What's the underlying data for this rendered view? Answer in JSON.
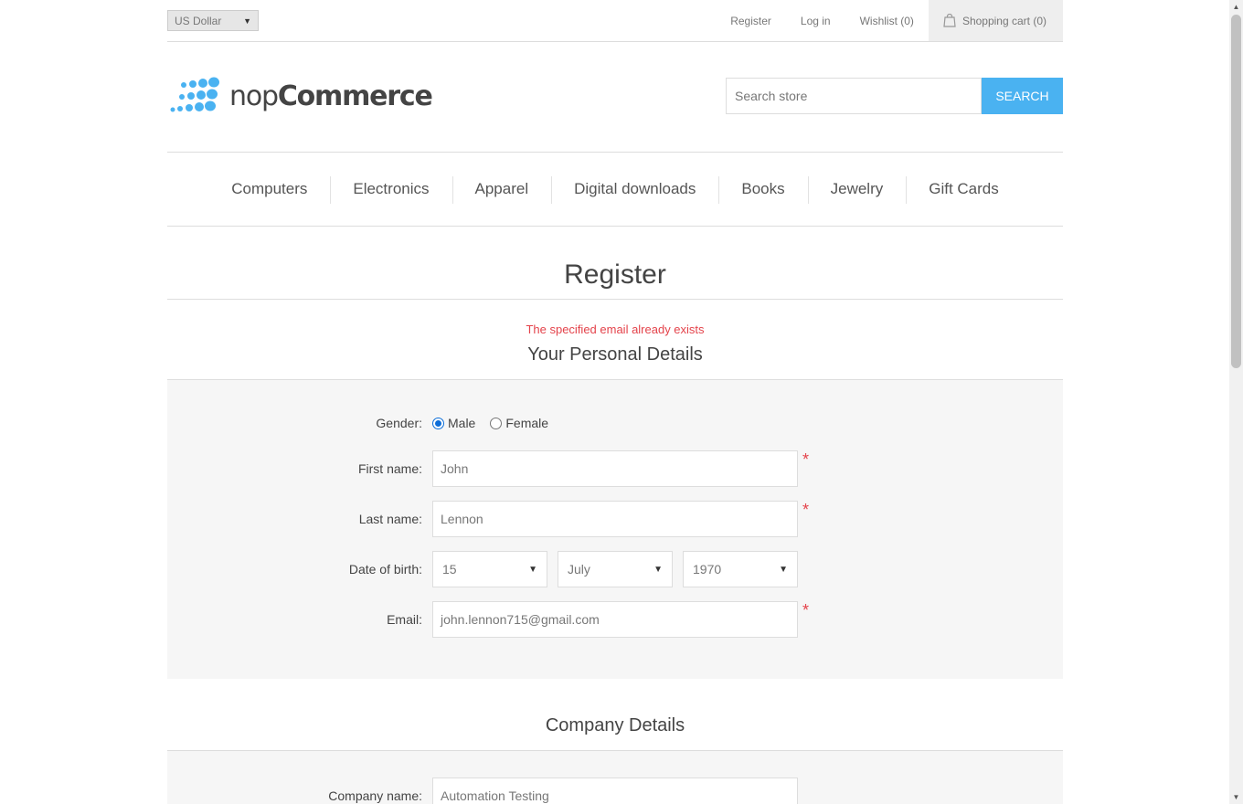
{
  "header": {
    "currency": "US Dollar",
    "links": {
      "register": "Register",
      "login": "Log in",
      "wishlist": "Wishlist (0)",
      "cart": "Shopping cart (0)"
    }
  },
  "logo": {
    "light": "nop",
    "bold": "Commerce",
    "color": "#4ab2f1"
  },
  "search": {
    "placeholder": "Search store",
    "button": "SEARCH"
  },
  "menu": [
    "Computers",
    "Electronics",
    "Apparel",
    "Digital downloads",
    "Books",
    "Jewelry",
    "Gift Cards"
  ],
  "page_title": "Register",
  "error_message": "The specified email already exists",
  "personal": {
    "title": "Your Personal Details",
    "gender_label": "Gender:",
    "gender_options": [
      "Male",
      "Female"
    ],
    "gender_selected": "Male",
    "first_name_label": "First name:",
    "first_name_value": "John",
    "last_name_label": "Last name:",
    "last_name_value": "Lennon",
    "dob_label": "Date of birth:",
    "dob_day": "15",
    "dob_month": "July",
    "dob_year": "1970",
    "email_label": "Email:",
    "email_value": "john.lennon715@gmail.com",
    "required_mark": "*"
  },
  "company": {
    "title": "Company Details",
    "name_label": "Company name:",
    "name_value": "Automation Testing"
  },
  "colors": {
    "accent": "#4ab2f1",
    "error": "#e4434b"
  }
}
